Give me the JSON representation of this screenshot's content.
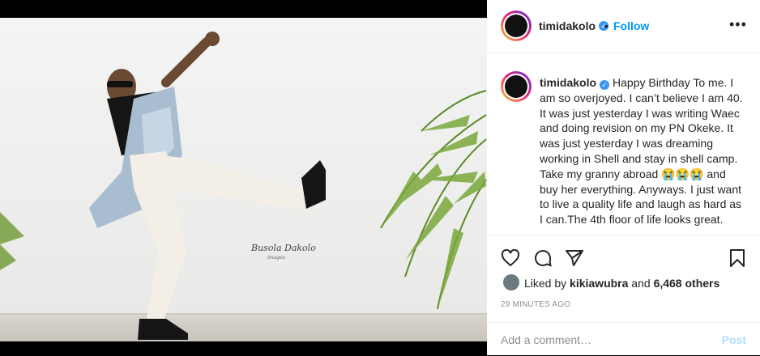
{
  "post": {
    "username": "timidakolo",
    "follow_label": "Follow",
    "separator": "•",
    "more_icon": "more-horizontal-icon",
    "caption": "Happy Birthday To me. I am so overjoyed. I can’t believe I am 40. It was just yesterday I was writing Waec and doing revision on my PN Okeke. It was just yesterday I was dreaming working in Shell and stay in shell camp. Take my granny abroad 😭😭😭 and buy her everything. Anyways. I just want to live a quality life and laugh as hard as I can.The 4th floor of life looks great.",
    "photo_watermark": "Busola Dakolo",
    "photo_watermark_sub": "images",
    "likes": {
      "prefix": "Liked by ",
      "user": "kikiawubra",
      "middle": " and ",
      "count": "6,468 others"
    },
    "time_ago": "29 MINUTES AGO",
    "comment_placeholder": "Add a comment…",
    "post_label": "Post",
    "accent_color": "#0095f6",
    "verified_color": "#3897f0"
  }
}
